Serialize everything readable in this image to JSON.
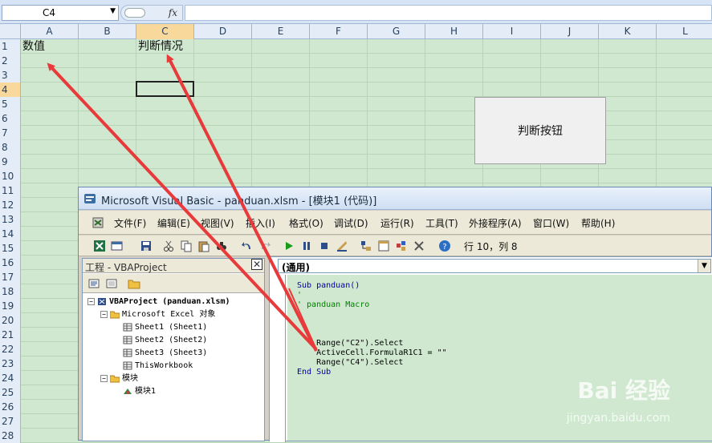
{
  "formula_bar": {
    "name_box": "C4",
    "fx": "fx",
    "formula": ""
  },
  "columns": [
    {
      "label": "A",
      "active": false
    },
    {
      "label": "B",
      "active": false
    },
    {
      "label": "C",
      "active": true
    },
    {
      "label": "D",
      "active": false
    },
    {
      "label": "E",
      "active": false
    },
    {
      "label": "F",
      "active": false
    },
    {
      "label": "G",
      "active": false
    },
    {
      "label": "H",
      "active": false
    },
    {
      "label": "I",
      "active": false
    },
    {
      "label": "J",
      "active": false
    },
    {
      "label": "K",
      "active": false
    },
    {
      "label": "L",
      "active": false
    }
  ],
  "rows": [
    "1",
    "2",
    "3",
    "4",
    "5",
    "6",
    "7",
    "8",
    "9",
    "10",
    "11",
    "12",
    "13",
    "14",
    "15",
    "16",
    "17",
    "18",
    "19",
    "20",
    "21",
    "22",
    "23",
    "24",
    "25",
    "26",
    "27",
    "28"
  ],
  "active_row": "4",
  "cells": {
    "A1": "数值",
    "C1": "判断情况"
  },
  "form_button": {
    "label": "判断按钮"
  },
  "vba": {
    "title": "Microsoft Visual Basic - panduan.xlsm - [模块1 (代码)]",
    "menu": [
      "文件(F)",
      "编辑(E)",
      "视图(V)",
      "插入(I)",
      "格式(O)",
      "调试(D)",
      "运行(R)",
      "工具(T)",
      "外接程序(A)",
      "窗口(W)",
      "帮助(H)"
    ],
    "cursor_position": "行 10，列 8",
    "project": {
      "title": "工程 - VBAProject",
      "close": "✕",
      "tree": [
        {
          "label": "VBAProject (panduan.xlsm)",
          "level": 0,
          "expander": "⊟"
        },
        {
          "label": "Microsoft Excel 对象",
          "level": 1,
          "expander": "⊟"
        },
        {
          "label": "Sheet1 (Sheet1)",
          "level": 2,
          "expander": ""
        },
        {
          "label": "Sheet2 (Sheet2)",
          "level": 2,
          "expander": ""
        },
        {
          "label": "Sheet3 (Sheet3)",
          "level": 2,
          "expander": ""
        },
        {
          "label": "ThisWorkbook",
          "level": 2,
          "expander": ""
        },
        {
          "label": "模块",
          "level": 1,
          "expander": "⊟"
        },
        {
          "label": "模块1",
          "level": 2,
          "expander": ""
        }
      ]
    },
    "code": {
      "procedure": "(通用)",
      "lines": [
        {
          "text": "Sub panduan()",
          "type": "kw"
        },
        {
          "text": "'",
          "type": "cm"
        },
        {
          "text": "' panduan Macro",
          "type": "cm"
        },
        {
          "text": "'",
          "type": "cm"
        },
        {
          "text": "",
          "type": "plain"
        },
        {
          "text": "'",
          "type": "cm"
        },
        {
          "text": "    Range(\"C2\").Select",
          "type": "plain"
        },
        {
          "text": "    ActiveCell.FormulaR1C1 = \"\"",
          "type": "plain"
        },
        {
          "text": "    Range(\"C4\").Select",
          "type": "plain"
        },
        {
          "text": "End Sub",
          "type": "kw"
        }
      ]
    }
  },
  "watermark": {
    "brand": "Bai 经验",
    "url": "jingyan.baidu.com"
  }
}
